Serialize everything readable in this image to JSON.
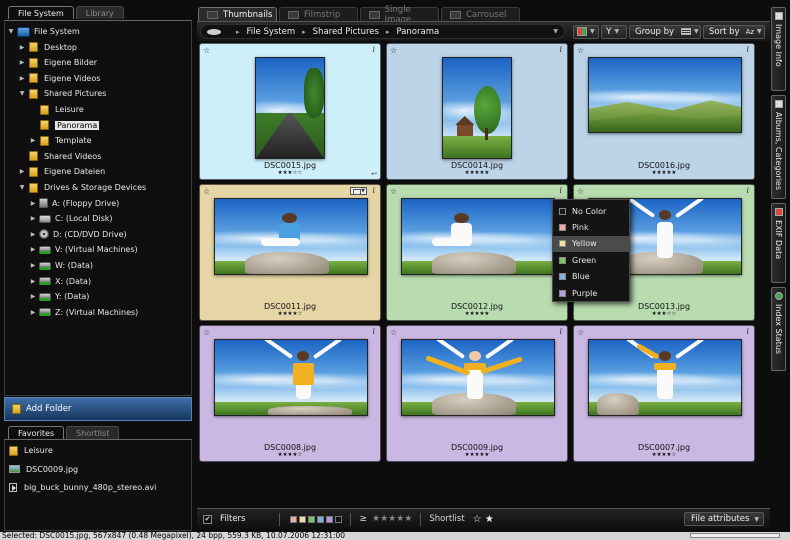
{
  "left_tabs": [
    "File System",
    "Library"
  ],
  "tree": [
    {
      "label": "File System",
      "icon": "computer-icon",
      "indent": 0,
      "expander": "▼"
    },
    {
      "label": "Desktop",
      "icon": "folder-icon",
      "indent": 1,
      "expander": "▶"
    },
    {
      "label": "Eigene Bilder",
      "icon": "folder-icon",
      "indent": 1,
      "expander": "▶"
    },
    {
      "label": "Eigene Videos",
      "icon": "folder-icon",
      "indent": 1,
      "expander": "▶"
    },
    {
      "label": "Shared Pictures",
      "icon": "folder-icon",
      "indent": 1,
      "expander": "▼"
    },
    {
      "label": "Leisure",
      "icon": "folder-icon",
      "indent": 2,
      "expander": ""
    },
    {
      "label": "Panorama",
      "icon": "folder-icon",
      "indent": 2,
      "expander": "",
      "selected": true
    },
    {
      "label": "Template",
      "icon": "folder-icon",
      "indent": 2,
      "expander": "▶"
    },
    {
      "label": "Shared Videos",
      "icon": "folder-icon",
      "indent": 1,
      "expander": ""
    },
    {
      "label": "Eigene Dateien",
      "icon": "folder-icon",
      "indent": 1,
      "expander": "▶"
    },
    {
      "label": "Drives & Storage Devices",
      "icon": "folder-icon",
      "indent": 1,
      "expander": "▼"
    },
    {
      "label": "A: (Floppy Drive)",
      "icon": "floppy-icon",
      "indent": 2,
      "expander": "▶"
    },
    {
      "label": "C: (Local Disk)",
      "icon": "disk-icon",
      "indent": 2,
      "expander": "▶"
    },
    {
      "label": "D: (CD/DVD Drive)",
      "icon": "cd-icon",
      "indent": 2,
      "expander": "▶"
    },
    {
      "label": "V: (Virtual Machines)",
      "icon": "network-drive-icon",
      "indent": 2,
      "expander": "▶"
    },
    {
      "label": "W: (Data)",
      "icon": "network-drive-icon",
      "indent": 2,
      "expander": "▶"
    },
    {
      "label": "X: (Data)",
      "icon": "network-drive-icon",
      "indent": 2,
      "expander": "▶"
    },
    {
      "label": "Y: (Data)",
      "icon": "network-drive-icon",
      "indent": 2,
      "expander": "▶"
    },
    {
      "label": "Z: (Virtual Machines)",
      "icon": "network-drive-icon",
      "indent": 2,
      "expander": "▶"
    }
  ],
  "add_folder_label": "Add Folder",
  "fav_tabs": [
    "Favorites",
    "Shortlist"
  ],
  "favorites": [
    {
      "label": "Leisure",
      "icon": "folder-icon"
    },
    {
      "label": "DSC0009.jpg",
      "icon": "image-file-icon"
    },
    {
      "label": "big_buck_bunny_480p_stereo.avi",
      "icon": "video-file-icon"
    }
  ],
  "main_tabs": [
    "Thumbnails",
    "Filmstrip",
    "Single Image",
    "Carrousel"
  ],
  "breadcrumb": [
    "File System",
    "Shared Pictures",
    "Panorama"
  ],
  "toolbar": {
    "group_label": "Group by",
    "sort_label": "Sort by",
    "sort_icon_text": "Az"
  },
  "thumbnails": [
    {
      "name": "DSC0015.jpg",
      "stars": "★★★☆☆",
      "color": "#cdeffa",
      "scene": "road"
    },
    {
      "name": "DSC0014.jpg",
      "stars": "★★★★★",
      "color": "#bcd3e8",
      "scene": "tree"
    },
    {
      "name": "DSC0016.jpg",
      "stars": "★★★★★",
      "color": "#bcd3e8",
      "scene": "hills"
    },
    {
      "name": "DSC0011.jpg",
      "stars": "★★★★☆",
      "color": "#e6d6a6",
      "scene": "sit-book"
    },
    {
      "name": "DSC0012.jpg",
      "stars": "★★★★★",
      "color": "#b8dcb0",
      "scene": "sit"
    },
    {
      "name": "DSC0013.jpg",
      "stars": "★★★☆☆",
      "color": "#b8dcb0",
      "scene": "stretch"
    },
    {
      "name": "DSC0008.jpg",
      "stars": "★★★★☆",
      "color": "#cbb8e2",
      "scene": "arms-up"
    },
    {
      "name": "DSC0009.jpg",
      "stars": "★★★★★",
      "color": "#cbb8e2",
      "scene": "scarf-wide"
    },
    {
      "name": "DSC0007.jpg",
      "stars": "★★★★☆",
      "color": "#cbb8e2",
      "scene": "scarf-up"
    }
  ],
  "color_menu": [
    {
      "label": "No Color",
      "swatch": "#1a1a1a"
    },
    {
      "label": "Pink",
      "swatch": "#f2a9a9"
    },
    {
      "label": "Yellow",
      "swatch": "#f3e09a",
      "highlighted": true
    },
    {
      "label": "Green",
      "swatch": "#7cc46a"
    },
    {
      "label": "Blue",
      "swatch": "#7fb0de"
    },
    {
      "label": "Purple",
      "swatch": "#b49ade"
    }
  ],
  "bottom": {
    "filters_label": "Filters",
    "filter_swatches": [
      "#f2a9a9",
      "#f3e09a",
      "#7cc46a",
      "#7fb0de",
      "#b49ade",
      "#111111"
    ],
    "rating_op": "≥",
    "rating_stars": "★★★★★",
    "shortlist_label": "Shortlist",
    "shortlist_icons": "☆ ★",
    "file_attributes_label": "File attributes"
  },
  "right_tabs": [
    "Image Info",
    "Albums, Categories",
    "EXIF Data",
    "Index Status"
  ],
  "status_text": "Selected: DSC0015.jpg, 567x847 (0.48 Megapixel), 24 bpp, 559.3 KB, 10.07.2006 12:31:00"
}
